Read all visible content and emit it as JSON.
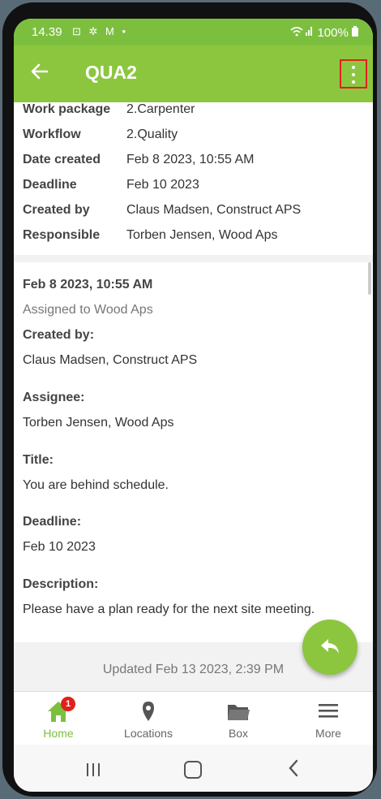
{
  "status": {
    "time": "14.39",
    "icons_left": "⊡ ✲ M •",
    "battery": "100%"
  },
  "header": {
    "title": "QUA2"
  },
  "details": [
    {
      "label": "Work package",
      "value": "2.Carpenter"
    },
    {
      "label": "Workflow",
      "value": "2.Quality"
    },
    {
      "label": "Date created",
      "value": "Feb 8 2023, 10:55 AM"
    },
    {
      "label": "Deadline",
      "value": "Feb 10 2023"
    },
    {
      "label": "Created by",
      "value": "Claus Madsen, Construct APS"
    },
    {
      "label": "Responsible",
      "value": "Torben Jensen, Wood Aps"
    }
  ],
  "event": {
    "date": "Feb 8 2023, 10:55 AM",
    "assigned": "Assigned to Wood Aps",
    "created_by_label": "Created by:",
    "created_by": "Claus Madsen, Construct APS",
    "assignee_label": "Assignee:",
    "assignee": "Torben Jensen, Wood Aps",
    "title_label": "Title:",
    "title": "You are behind schedule.",
    "deadline_label": "Deadline:",
    "deadline": "Feb 10 2023",
    "description_label": "Description:",
    "description": "Please have a plan ready for the next site meeting."
  },
  "updated": "Updated Feb 13 2023, 2:39 PM",
  "nav": [
    {
      "label": "Home",
      "icon": "home-icon",
      "badge": "1"
    },
    {
      "label": "Locations",
      "icon": "location-pin-icon"
    },
    {
      "label": "Box",
      "icon": "folder-icon"
    },
    {
      "label": "More",
      "icon": "hamburger-icon"
    }
  ],
  "colors": {
    "accent": "#8cc63f",
    "badge": "#e0211b"
  }
}
